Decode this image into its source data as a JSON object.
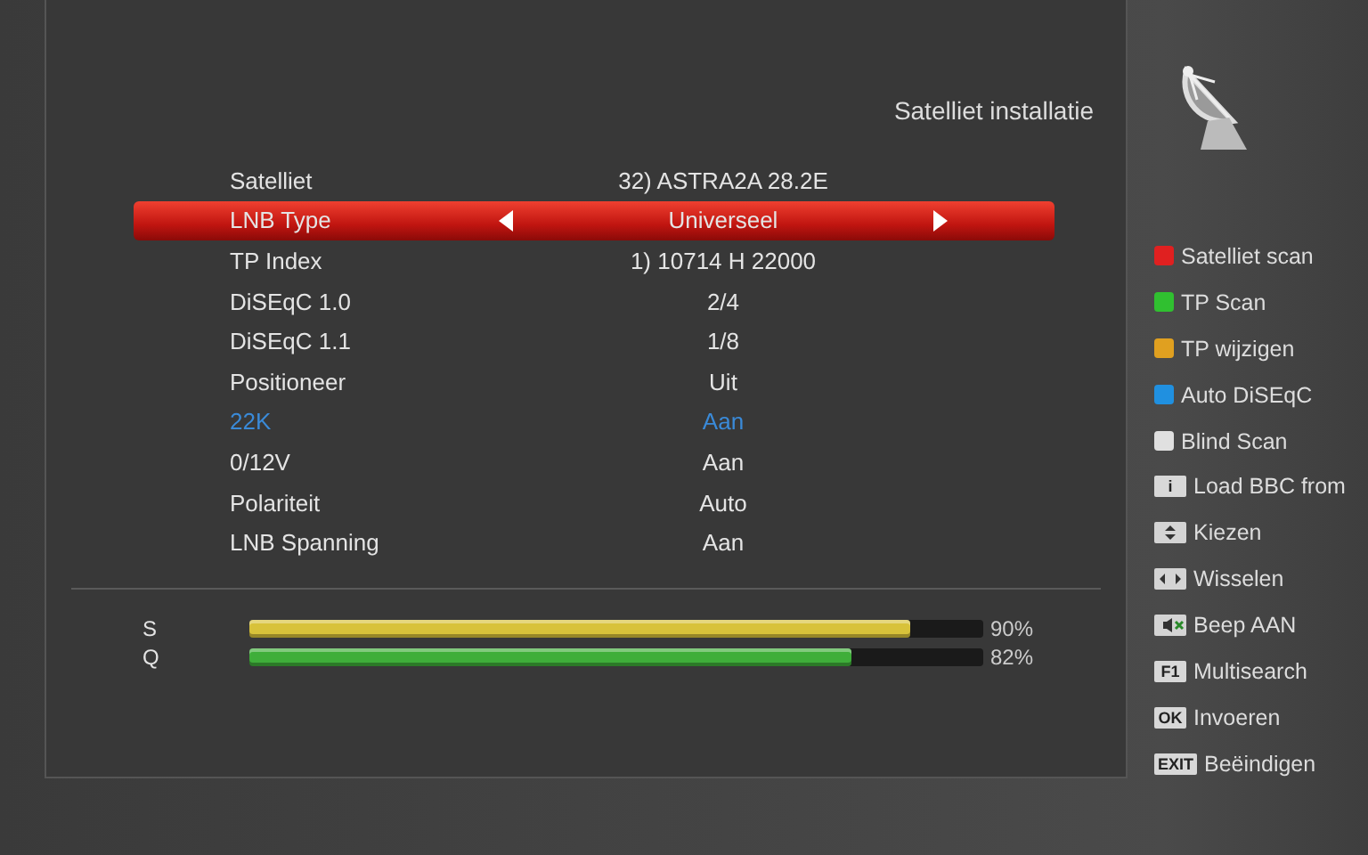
{
  "header": {
    "title": "Satelliet installatie"
  },
  "settings": [
    {
      "label": "Satelliet",
      "value": "32) ASTRA2A 28.2E",
      "selected": false,
      "highlighted": false
    },
    {
      "label": "LNB Type",
      "value": "Universeel",
      "selected": true,
      "highlighted": false
    },
    {
      "label": "TP Index",
      "value": "1) 10714 H 22000",
      "selected": false,
      "highlighted": false
    },
    {
      "label": "DiSEqC 1.0",
      "value": "2/4",
      "selected": false,
      "highlighted": false
    },
    {
      "label": "DiSEqC 1.1",
      "value": "1/8",
      "selected": false,
      "highlighted": false
    },
    {
      "label": "Positioneer",
      "value": "Uit",
      "selected": false,
      "highlighted": false
    },
    {
      "label": "22K",
      "value": "Aan",
      "selected": false,
      "highlighted": true
    },
    {
      "label": "0/12V",
      "value": "Aan",
      "selected": false,
      "highlighted": false
    },
    {
      "label": "Polariteit",
      "value": "Auto",
      "selected": false,
      "highlighted": false
    },
    {
      "label": "LNB Spanning",
      "value": "Aan",
      "selected": false,
      "highlighted": false
    }
  ],
  "meters": [
    {
      "label": "S",
      "level": 0.9,
      "reading": "90%",
      "color": "#d8c23a"
    },
    {
      "label": "Q",
      "level": 0.82,
      "reading": "82%",
      "color": "#3fae3a"
    }
  ],
  "legend": [
    {
      "kind": "color",
      "color": "#e02020",
      "label": "Satelliet scan"
    },
    {
      "kind": "color",
      "color": "#30c030",
      "label": "TP Scan"
    },
    {
      "kind": "color",
      "color": "#e0a020",
      "label": "TP wijzigen"
    },
    {
      "kind": "color",
      "color": "#2090e0",
      "label": "Auto DiSEqC"
    },
    {
      "kind": "color",
      "color": "#e0e0e0",
      "label": "Blind Scan"
    },
    {
      "kind": "key",
      "key": "i",
      "label": "Load BBC from"
    },
    {
      "kind": "updown",
      "label": "Kiezen"
    },
    {
      "kind": "leftright",
      "label": "Wisselen"
    },
    {
      "kind": "mute",
      "label": "Beep AAN"
    },
    {
      "kind": "key",
      "key": "F1",
      "label": "Multisearch"
    },
    {
      "kind": "key",
      "key": "OK",
      "label": "Invoeren"
    },
    {
      "kind": "key",
      "key": "EXIT",
      "label": "Beëindigen"
    }
  ]
}
